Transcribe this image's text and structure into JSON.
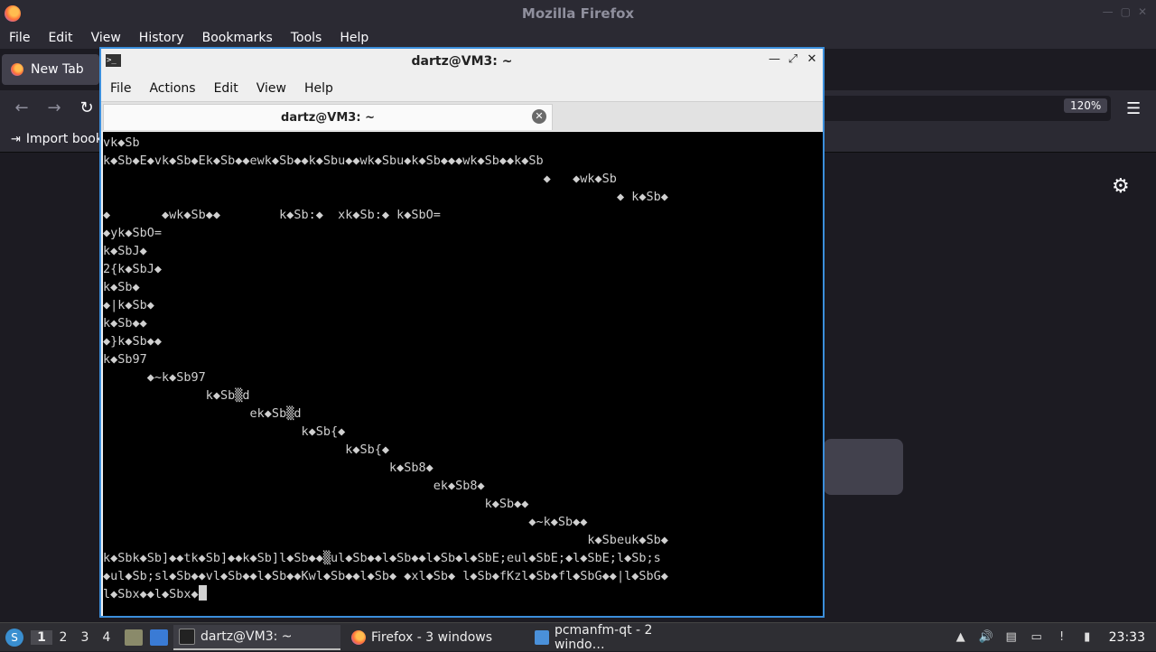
{
  "firefox": {
    "window_title": "Mozilla Firefox",
    "menu": [
      "File",
      "Edit",
      "View",
      "History",
      "Bookmarks",
      "Tools",
      "Help"
    ],
    "tab_label": "New Tab",
    "zoom": "120%",
    "bookmarks_import_label": "Import book"
  },
  "terminal": {
    "title": "dartz@VM3: ~",
    "menu": [
      "File",
      "Actions",
      "Edit",
      "View",
      "Help"
    ],
    "tab_label": "dartz@VM3: ~",
    "lines": [
      "vk◆Sb",
      "k◆Sb◆E◆vk◆Sb◆Ek◆Sb◆◆ewk◆Sb◆◆k◆Sbu◆◆wk◆Sbu◆k◆Sb◆◆◆wk◆Sb◆◆k◆Sb",
      "                                                            ◆   ◆wk◆Sb",
      "                                                                      ◆ k◆Sb◆",
      "◆       ◆wk◆Sb◆◆        k◆Sb:◆  xk◆Sb:◆ k◆SbO=",
      "◆yk◆SbO=",
      "k◆SbJ◆",
      "2{k◆SbJ◆",
      "k◆Sb◆",
      "◆|k◆Sb◆",
      "k◆Sb◆◆",
      "◆}k◆Sb◆◆",
      "k◆Sb97",
      "      ◆~k◆Sb97",
      "              k◆Sb▒d",
      "                    ek◆Sb▒d",
      "                           k◆Sb{◆",
      "                                 k◆Sb{◆",
      "                                       k◆Sb8◆",
      "                                             ek◆Sb8◆",
      "                                                    k◆Sb◆◆",
      "                                                          ◆~k◆Sb◆◆",
      "                                                                  k◆Sbeuk◆Sb◆",
      "k◆Sbk◆Sb]◆◆tk◆Sb]◆◆k◆Sb]l◆Sb◆◆▒ul◆Sb◆◆l◆Sb◆◆l◆Sb◆l◆SbE;eul◆SbE;◆l◆SbE;l◆Sb;s",
      "◆ul◆Sb;sl◆Sb◆◆vl◆Sb◆◆l◆Sb◆◆Kwl◆Sb◆◆l◆Sb◆ ◆xl◆Sb◆ l◆Sb◆fKzl◆Sb◆fl◆SbG◆◆|l◆SbG◆",
      "l◆Sbx◆◆l◆Sbx◆"
    ]
  },
  "taskbar": {
    "desktops": [
      "1",
      "2",
      "3",
      "4"
    ],
    "tasks": [
      {
        "label": "dartz@VM3: ~",
        "icon": "terminal-icon"
      },
      {
        "label": "Firefox - 3 windows",
        "icon": "firefox-icon"
      },
      {
        "label": "pcmanfm-qt - 2 windo…",
        "icon": "folder-icon"
      }
    ],
    "clock": "23:33"
  }
}
